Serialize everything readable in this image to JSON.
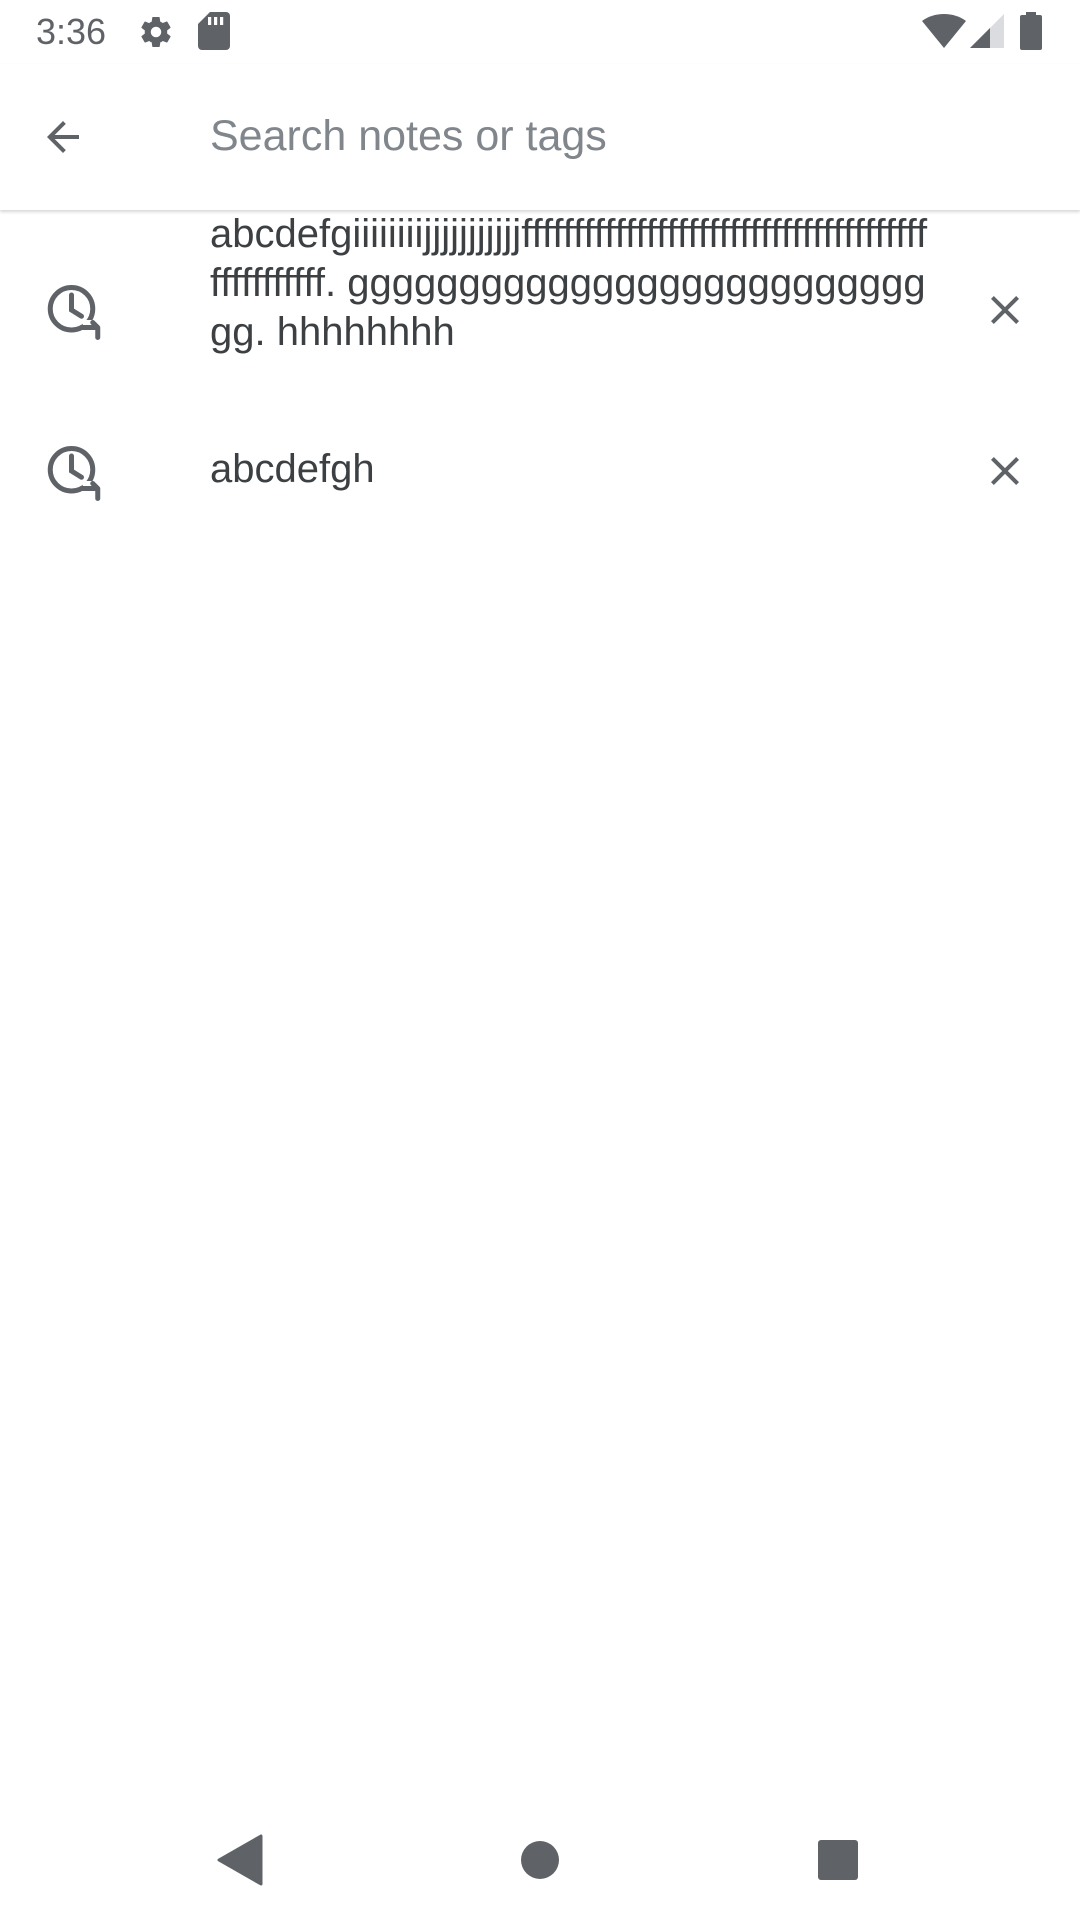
{
  "status_bar": {
    "time": "3:36",
    "icons": [
      "settings-icon",
      "sd-card-icon",
      "wifi-icon",
      "cell-signal-icon",
      "battery-icon"
    ]
  },
  "toolbar": {
    "back_icon": "arrow-back-icon",
    "search_placeholder": "Search notes or tags",
    "search_value": ""
  },
  "suggestions": [
    {
      "icon": "history-icon",
      "text": "abcdefgiiiiiiiijjjjjjjjjjjffffffffffffffffffffffffffffffffffffffffffffffffff. gggggggggggggggggggggggggggg. hhhhhhhh",
      "remove_icon": "close-icon"
    },
    {
      "icon": "history-icon",
      "text": "abcdefgh",
      "remove_icon": "close-icon"
    }
  ],
  "nav_bar": {
    "buttons": [
      "back-triangle-icon",
      "home-circle-icon",
      "recents-square-icon"
    ]
  },
  "colors": {
    "icon_gray": "#5f6368",
    "text": "#3c4043",
    "placeholder": "#80868b",
    "background": "#ffffff"
  }
}
